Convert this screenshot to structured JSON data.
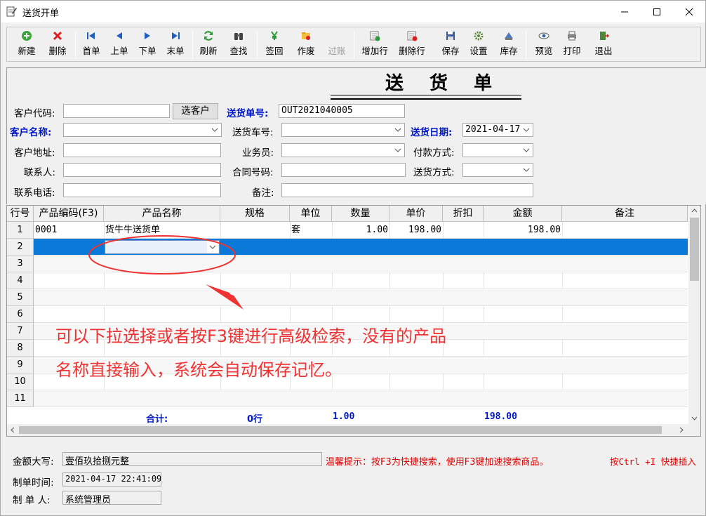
{
  "window": {
    "title": "送货开单",
    "minimize_icon": "minimize-icon",
    "maximize_icon": "maximize-icon",
    "close_icon": "close-icon"
  },
  "toolbar": {
    "new": "新建",
    "delete": "删除",
    "first": "首单",
    "prev": "上单",
    "next": "下单",
    "last": "末单",
    "refresh": "刷新",
    "search": "查找",
    "sign_back": "签回",
    "void": "作废",
    "post": "过账",
    "add_row": "增加行",
    "delete_row": "删除行",
    "save": "保存",
    "settings": "设置",
    "stock": "库存",
    "preview": "预览",
    "print": "打印",
    "exit": "退出"
  },
  "doc_title": "送 货 单",
  "form": {
    "customer_code_label": "客户代码:",
    "customer_code_value": "",
    "select_customer_button": "选客户",
    "delivery_no_label": "送货单号:",
    "delivery_no_value": "OUT2021040005",
    "customer_name_label": "客户名称:",
    "customer_name_value": "",
    "vehicle_no_label": "送货车号:",
    "vehicle_no_value": "",
    "delivery_date_label": "送货日期:",
    "delivery_date_value": "2021-04-17",
    "customer_address_label": "客户地址:",
    "customer_address_value": "",
    "salesman_label": "业务员:",
    "salesman_value": "",
    "payment_method_label": "付款方式:",
    "payment_method_value": "",
    "contact_label": "联系人:",
    "contact_value": "",
    "contract_no_label": "合同号码:",
    "contract_no_value": "",
    "delivery_method_label": "送货方式:",
    "delivery_method_value": "",
    "phone_label": "联系电话:",
    "phone_value": "",
    "remark_label": "备注:",
    "remark_value": ""
  },
  "grid": {
    "headers": [
      "行号",
      "产品编码(F3)",
      "产品名称",
      "规格",
      "单位",
      "数量",
      "单价",
      "折扣",
      "金额",
      "备注"
    ],
    "rows": [
      {
        "no": "1",
        "code": "0001",
        "name": "货牛牛送货单",
        "spec": "",
        "unit": "套",
        "qty": "1.00",
        "price": "198.00",
        "discount": "",
        "amount": "198.00",
        "remark": ""
      },
      {
        "no": "2"
      },
      {
        "no": "3"
      },
      {
        "no": "4"
      },
      {
        "no": "5"
      },
      {
        "no": "6"
      },
      {
        "no": "7"
      },
      {
        "no": "8"
      },
      {
        "no": "9"
      },
      {
        "no": "10"
      },
      {
        "no": "11"
      }
    ],
    "totals": {
      "label": "合计:",
      "rows": "0行",
      "qty": "1.00",
      "amount": "198.00"
    }
  },
  "annotation": {
    "line1": "可以下拉选择或者按F3键进行高级检索，没有的产品",
    "line2": "名称直接输入，系统会自动保存记忆。",
    "color": "#f03232"
  },
  "footer": {
    "amount_words_label": "金额大写:",
    "amount_words_value": "壹佰玖拾捌元整",
    "tip": "温馨提示：按F3为快捷搜索，使用F3键加速搜索商品。",
    "shortcut_tip": "按Ctrl +I 快捷插入",
    "created_time_label": "制单时间:",
    "created_time_value": "2021-04-17 22:41:09",
    "creator_label": "制 单 人:",
    "creator_value": "系统管理员"
  },
  "colors": {
    "selected_row": "#0a78d7",
    "blue_label": "#0018c9",
    "warning": "#e10000"
  }
}
